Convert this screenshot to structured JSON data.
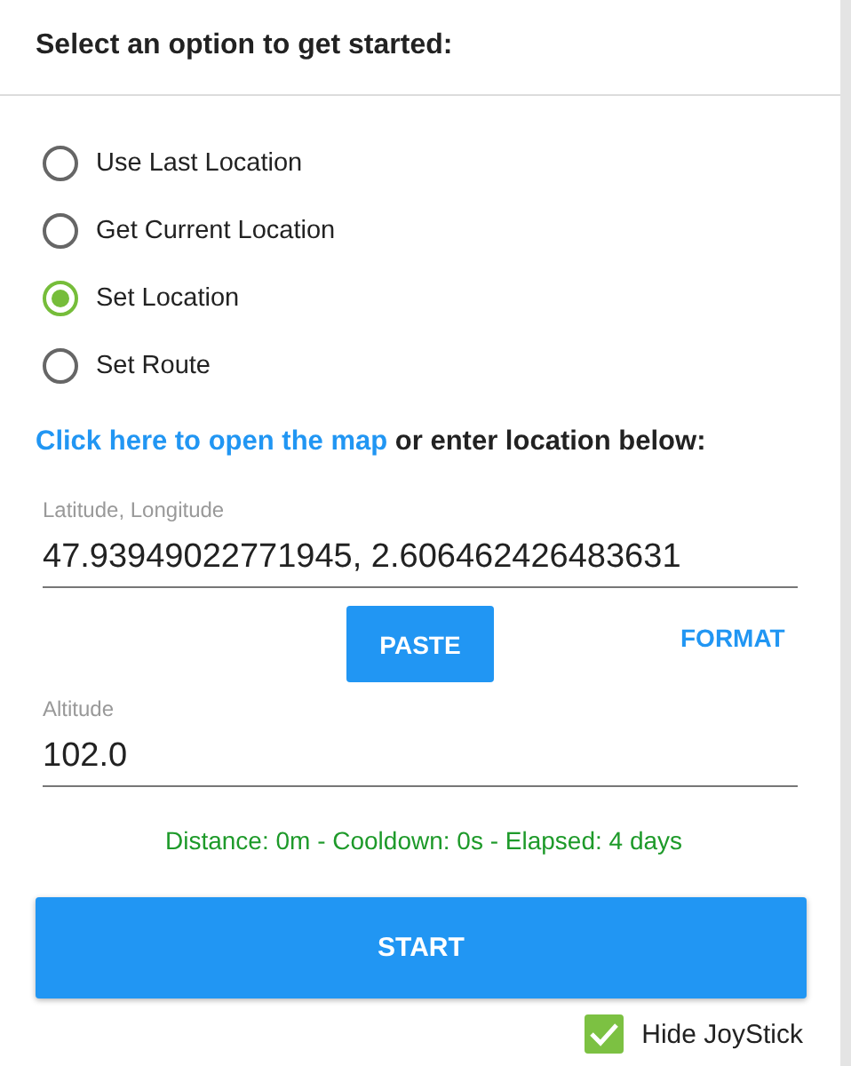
{
  "header": {
    "title": "Select an option to get started:"
  },
  "options": [
    {
      "label": "Use Last Location",
      "selected": false
    },
    {
      "label": "Get Current Location",
      "selected": false
    },
    {
      "label": "Set Location",
      "selected": true
    },
    {
      "label": "Set Route",
      "selected": false
    }
  ],
  "map_prompt": {
    "link": "Click here to open the map",
    "text": "or enter location below:"
  },
  "coordinates": {
    "label": "Latitude, Longitude",
    "value": "47.93949022771945, 2.606462426483631"
  },
  "buttons": {
    "paste": "PASTE",
    "format": "FORMAT"
  },
  "altitude": {
    "label": "Altitude",
    "value": "102.0"
  },
  "status": "Distance: 0m - Cooldown: 0s - Elapsed: 4 days",
  "start": "START",
  "hide_joystick": {
    "label": "Hide JoyStick",
    "checked": true
  }
}
